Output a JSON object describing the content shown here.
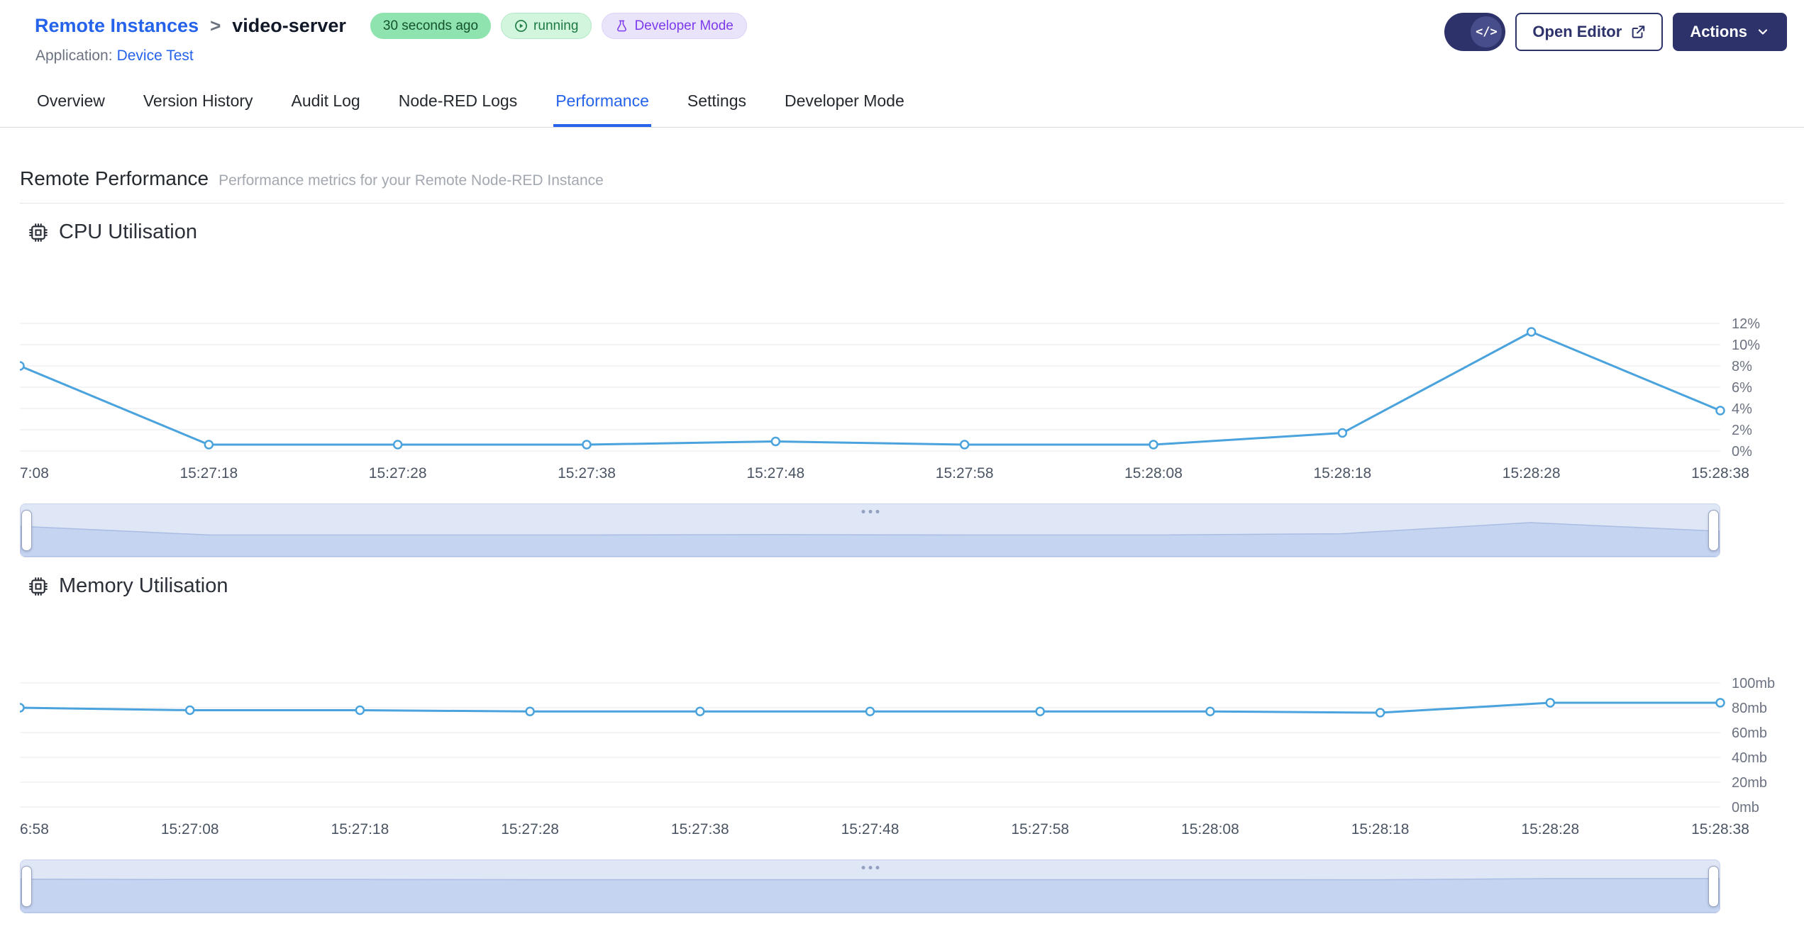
{
  "header": {
    "breadcrumb": {
      "parent": "Remote Instances",
      "separator": ">",
      "current": "video-server"
    },
    "badges": {
      "last_seen": {
        "label": "30 seconds ago"
      },
      "status": {
        "label": "running"
      },
      "mode": {
        "label": "Developer Mode"
      }
    },
    "application_label": "Application:",
    "application_name": "Device Test",
    "buttons": {
      "code_glyph": "</>",
      "open_editor": "Open Editor",
      "actions": "Actions"
    }
  },
  "tabs": {
    "active": "Performance",
    "items": [
      {
        "label": "Overview"
      },
      {
        "label": "Version History"
      },
      {
        "label": "Audit Log"
      },
      {
        "label": "Node-RED Logs"
      },
      {
        "label": "Performance"
      },
      {
        "label": "Settings"
      },
      {
        "label": "Developer Mode"
      }
    ]
  },
  "page": {
    "title": "Remote Performance",
    "subtitle": "Performance metrics for your Remote Node-RED Instance"
  },
  "sections": {
    "cpu": {
      "title": "CPU Utilisation"
    },
    "memory": {
      "title": "Memory Utilisation"
    }
  },
  "chart_data": [
    {
      "id": "cpu",
      "type": "line",
      "title": "CPU Utilisation",
      "x": [
        "7:08",
        "15:27:18",
        "15:27:28",
        "15:27:38",
        "15:27:48",
        "15:27:58",
        "15:28:08",
        "15:28:18",
        "15:28:28",
        "15:28:38"
      ],
      "values": [
        8,
        0.6,
        0.6,
        0.6,
        0.9,
        0.6,
        0.6,
        1.7,
        11.2,
        3.8
      ],
      "ylim": [
        0,
        12
      ],
      "ytick_labels": [
        "12%",
        "10%",
        "8%",
        "6%",
        "4%",
        "2%",
        "0%"
      ],
      "unit": "%",
      "y_axis_position": "right",
      "grid": true,
      "legend": "none",
      "has_range_slider": true
    },
    {
      "id": "memory",
      "type": "line",
      "title": "Memory Utilisation",
      "x": [
        "6:58",
        "15:27:08",
        "15:27:18",
        "15:27:28",
        "15:27:38",
        "15:27:48",
        "15:27:58",
        "15:28:08",
        "15:28:18",
        "15:28:28",
        "15:28:38"
      ],
      "values": [
        80,
        78,
        78,
        77,
        77,
        77,
        77,
        77,
        76,
        84,
        84
      ],
      "ylim": [
        0,
        100
      ],
      "ytick_labels": [
        "100mb",
        "80mb",
        "60mb",
        "40mb",
        "20mb",
        "0mb"
      ],
      "unit": "mb",
      "y_axis_position": "right",
      "grid": true,
      "legend": "none",
      "has_range_slider": true
    }
  ],
  "colors": {
    "link_blue": "#2563eb",
    "active_tab": "#2563eb",
    "line_blue": "#4aa3dc",
    "navy": "#2d326b",
    "badge_green_bg": "#8ee3ae",
    "badge_green_text": "#14532d",
    "status_bg": "#d2f5de",
    "status_text": "#1c7a42",
    "devmode_bg": "#eae4fb",
    "devmode_text": "#7c3aed",
    "brush_bg": "#dfe7f7",
    "brush_area": "#c5d4f0"
  }
}
